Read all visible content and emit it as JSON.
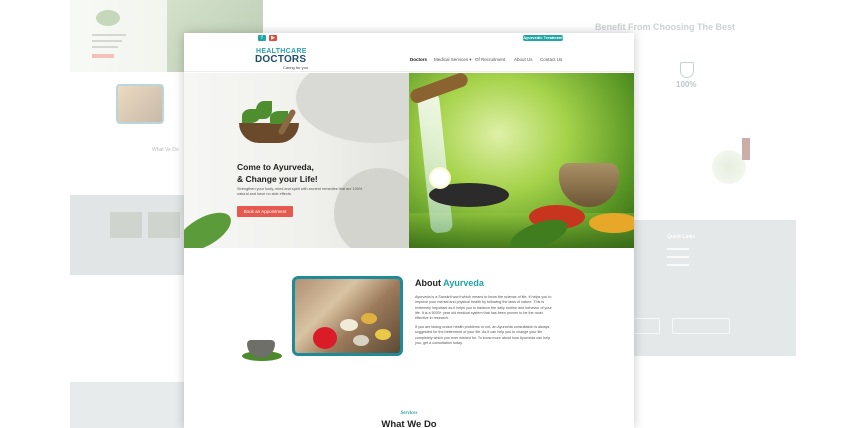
{
  "header": {
    "logo_line1": "HEALTHCARE",
    "logo_line2": "DOCTORS",
    "tagline": "Caring for you",
    "top_button": "Ayurvedic Treatment",
    "nav": [
      "Doctors",
      "Medical Services ▾",
      "Of Recruitment",
      "About Us",
      "Contact Us"
    ]
  },
  "hero": {
    "heading_line1": "Come to Ayurveda,",
    "heading_line2": "& Change your Life!",
    "text": "Strengthen your body, mind and spirit with ancient remedies that are 100% natural and have no side effects.",
    "button": "Book an Appointment"
  },
  "about": {
    "heading_prefix": "About",
    "heading_accent": "Ayurveda",
    "para1": "Ayurveda is a Sanskrit word which means to know the science of life. It helps you to improve your mental and physical health by following the laws of nature. This is extremely important as it helps you to balance the daily routine and behavior of your life. It is a 5000+ year old medical system that has been proven to be the most effective in research.",
    "para2": "If you are facing undue health problems or not, an Ayurveda consultation is always suggested for the betterment of your life. As it can help you to change your life completely which you ever wished for. To know more about how Ayurveda can help you, get a consultation today."
  },
  "services": {
    "label": "Services",
    "heading": "What We Do"
  },
  "bg_right": {
    "heading": "Benefit From Choosing The Best",
    "stat": "100%",
    "quick_links": "Quick Links"
  },
  "bg_left": {
    "section_title": "What Ve Do"
  },
  "colors": {
    "teal": "#1fa3a8",
    "navy": "#1f4d6e",
    "cta_red": "#e5594e"
  }
}
